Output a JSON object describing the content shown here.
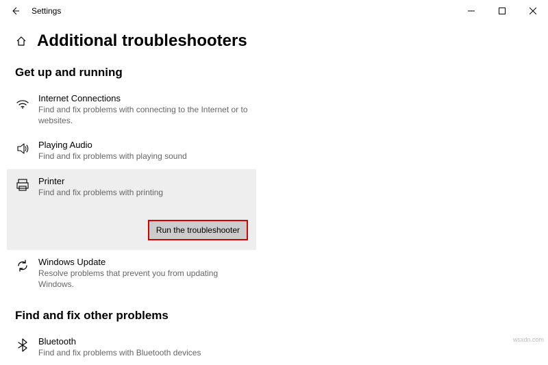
{
  "window": {
    "title": "Settings"
  },
  "page": {
    "heading": "Additional troubleshooters"
  },
  "sections": {
    "getup": "Get up and running",
    "other": "Find and fix other problems"
  },
  "items": {
    "internet": {
      "name": "Internet Connections",
      "desc": "Find and fix problems with connecting to the Internet or to websites."
    },
    "audio": {
      "name": "Playing Audio",
      "desc": "Find and fix problems with playing sound"
    },
    "printer": {
      "name": "Printer",
      "desc": "Find and fix problems with printing"
    },
    "update": {
      "name": "Windows Update",
      "desc": "Resolve problems that prevent you from updating Windows."
    },
    "bluetooth": {
      "name": "Bluetooth",
      "desc": "Find and fix problems with Bluetooth devices"
    }
  },
  "buttons": {
    "run": "Run the troubleshooter"
  },
  "watermark": "wsxdn.com"
}
